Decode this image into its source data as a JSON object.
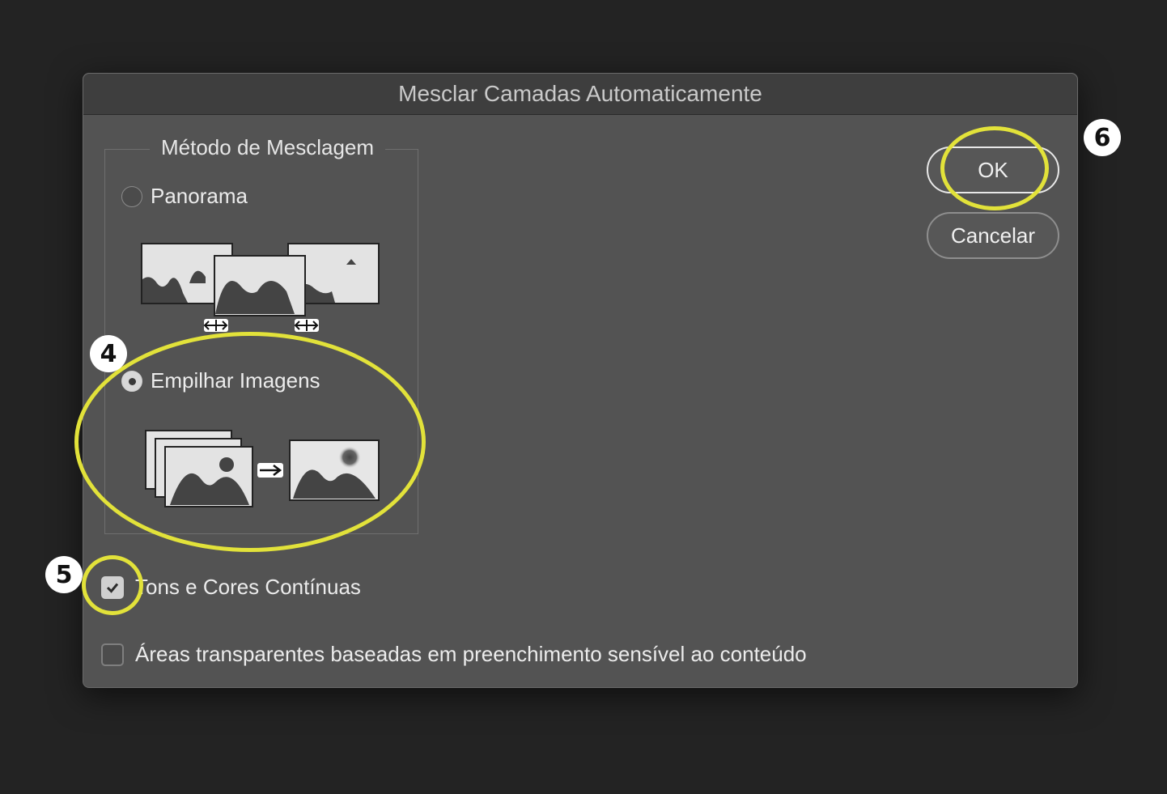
{
  "dialog": {
    "title": "Mesclar Camadas Automaticamente"
  },
  "blend_method": {
    "legend": "Método de Mesclagem",
    "options": [
      {
        "label": "Panorama",
        "selected": false
      },
      {
        "label": "Empilhar Imagens",
        "selected": true
      }
    ]
  },
  "options": {
    "seamless_tones": {
      "label": "Tons e Cores Contínuas",
      "checked": true
    },
    "content_aware_fill": {
      "label": "Áreas transparentes baseadas em preenchimento sensível ao conteúdo",
      "checked": false
    }
  },
  "buttons": {
    "ok": "OK",
    "cancel": "Cancelar"
  },
  "annotations": {
    "step_4": "4",
    "step_5": "5",
    "step_6": "6",
    "highlight_color": "#e2e23a"
  },
  "icons": [
    "panorama-illustration",
    "stack-images-illustration",
    "arrow-right-icon",
    "resize-arrows-icon",
    "checkmark-icon"
  ]
}
